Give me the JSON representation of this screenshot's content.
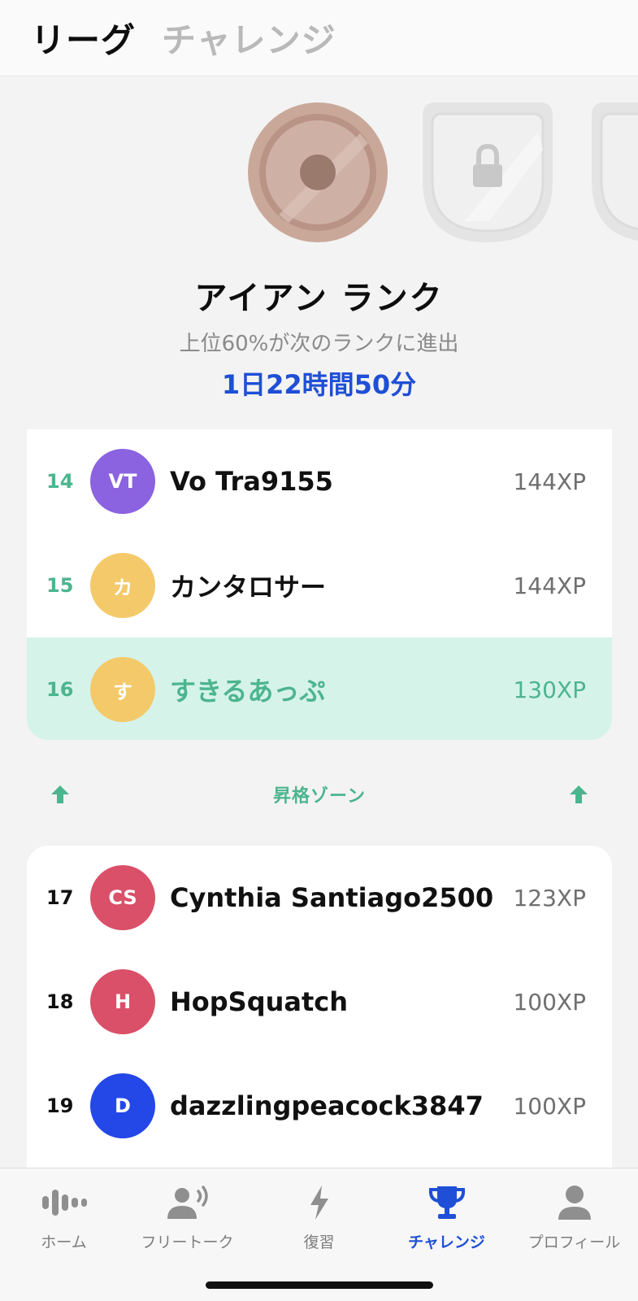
{
  "header": {
    "tab_league": "リーグ",
    "tab_challenge": "チャレンジ"
  },
  "badges": [
    {
      "name": "iron-medal",
      "state": "current",
      "color": "#c9a89a"
    },
    {
      "name": "locked-badge",
      "state": "locked"
    },
    {
      "name": "locked-badge",
      "state": "locked"
    }
  ],
  "rank": {
    "title": "アイアン ランク",
    "description": "上位60%が次のランクに進出",
    "timer": "1日22時間50分"
  },
  "leaderboard_top": [
    {
      "rank": "14",
      "initials": "VT",
      "name": "Vo Tra9155",
      "xp": "144XP",
      "avatar_color": "#8b62e0"
    },
    {
      "rank": "15",
      "initials": "カ",
      "name": "カンタロサー",
      "xp": "144XP",
      "avatar_color": "#f4c96a"
    },
    {
      "rank": "16",
      "initials": "す",
      "name": "すきるあっぷ",
      "xp": "130XP",
      "avatar_color": "#f4c96a",
      "is_current_user": true
    }
  ],
  "promotion_zone": {
    "label": "昇格ゾーン",
    "icon": "up-arrow-icon"
  },
  "leaderboard_bottom": [
    {
      "rank": "17",
      "initials": "CS",
      "name": "Cynthia Santiago2500",
      "xp": "123XP",
      "avatar_color": "#d95068"
    },
    {
      "rank": "18",
      "initials": "H",
      "name": "HopSquatch",
      "xp": "100XP",
      "avatar_color": "#d95068"
    },
    {
      "rank": "19",
      "initials": "D",
      "name": "dazzlingpeacock3847",
      "xp": "100XP",
      "avatar_color": "#2447e8"
    }
  ],
  "bottom_nav": [
    {
      "label": "ホーム",
      "icon": "waveform-icon",
      "active": false
    },
    {
      "label": "フリートーク",
      "icon": "person-speaking-icon",
      "active": false
    },
    {
      "label": "復習",
      "icon": "lightning-icon",
      "active": false
    },
    {
      "label": "チャレンジ",
      "icon": "trophy-icon",
      "active": true
    },
    {
      "label": "プロフィール",
      "icon": "person-icon",
      "active": false
    }
  ],
  "colors": {
    "accent_green": "#4cb58f",
    "accent_blue": "#1f4fd6",
    "highlight_row": "#d6f3ea"
  }
}
